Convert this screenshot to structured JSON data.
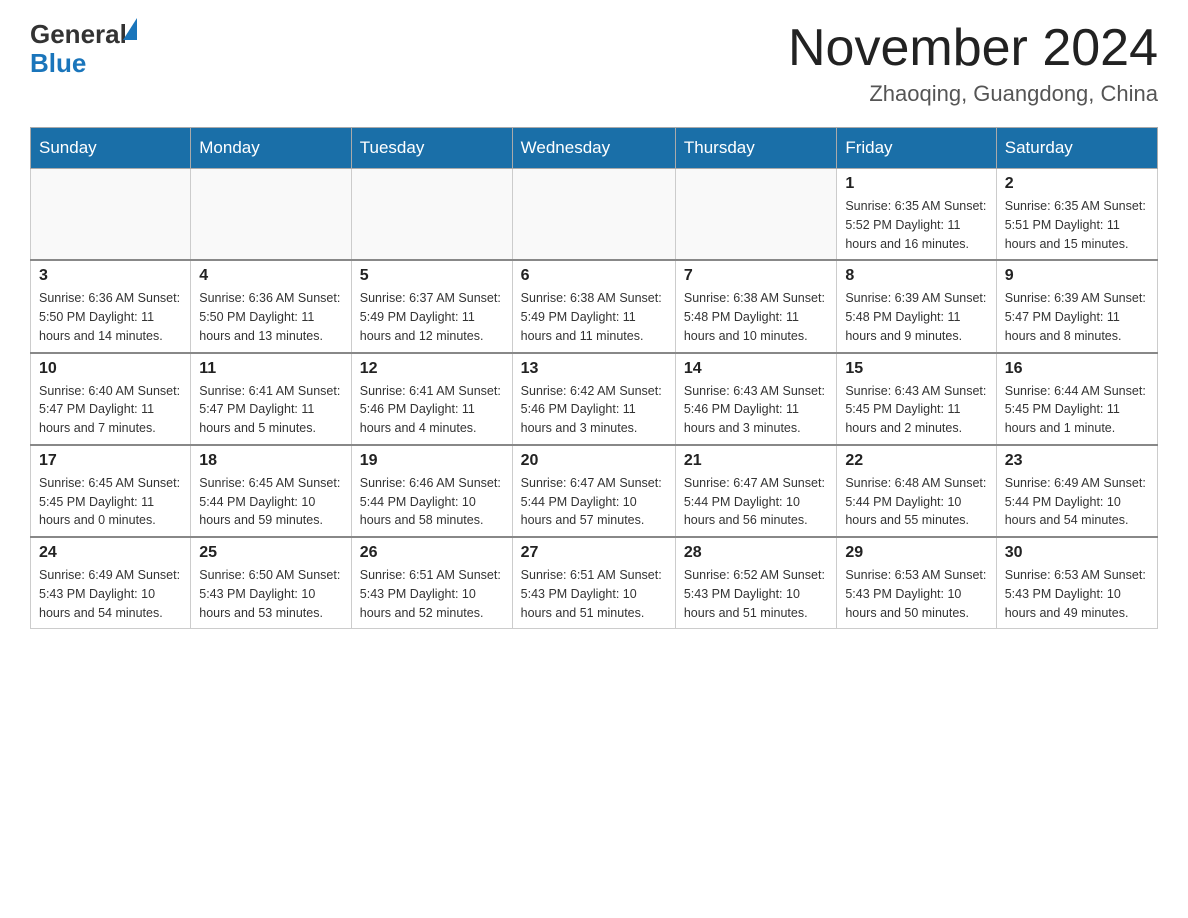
{
  "header": {
    "logo_general": "General",
    "logo_blue": "Blue",
    "title": "November 2024",
    "subtitle": "Zhaoqing, Guangdong, China"
  },
  "weekdays": [
    "Sunday",
    "Monday",
    "Tuesday",
    "Wednesday",
    "Thursday",
    "Friday",
    "Saturday"
  ],
  "weeks": [
    [
      {
        "day": "",
        "info": ""
      },
      {
        "day": "",
        "info": ""
      },
      {
        "day": "",
        "info": ""
      },
      {
        "day": "",
        "info": ""
      },
      {
        "day": "",
        "info": ""
      },
      {
        "day": "1",
        "info": "Sunrise: 6:35 AM\nSunset: 5:52 PM\nDaylight: 11 hours and 16 minutes."
      },
      {
        "day": "2",
        "info": "Sunrise: 6:35 AM\nSunset: 5:51 PM\nDaylight: 11 hours and 15 minutes."
      }
    ],
    [
      {
        "day": "3",
        "info": "Sunrise: 6:36 AM\nSunset: 5:50 PM\nDaylight: 11 hours and 14 minutes."
      },
      {
        "day": "4",
        "info": "Sunrise: 6:36 AM\nSunset: 5:50 PM\nDaylight: 11 hours and 13 minutes."
      },
      {
        "day": "5",
        "info": "Sunrise: 6:37 AM\nSunset: 5:49 PM\nDaylight: 11 hours and 12 minutes."
      },
      {
        "day": "6",
        "info": "Sunrise: 6:38 AM\nSunset: 5:49 PM\nDaylight: 11 hours and 11 minutes."
      },
      {
        "day": "7",
        "info": "Sunrise: 6:38 AM\nSunset: 5:48 PM\nDaylight: 11 hours and 10 minutes."
      },
      {
        "day": "8",
        "info": "Sunrise: 6:39 AM\nSunset: 5:48 PM\nDaylight: 11 hours and 9 minutes."
      },
      {
        "day": "9",
        "info": "Sunrise: 6:39 AM\nSunset: 5:47 PM\nDaylight: 11 hours and 8 minutes."
      }
    ],
    [
      {
        "day": "10",
        "info": "Sunrise: 6:40 AM\nSunset: 5:47 PM\nDaylight: 11 hours and 7 minutes."
      },
      {
        "day": "11",
        "info": "Sunrise: 6:41 AM\nSunset: 5:47 PM\nDaylight: 11 hours and 5 minutes."
      },
      {
        "day": "12",
        "info": "Sunrise: 6:41 AM\nSunset: 5:46 PM\nDaylight: 11 hours and 4 minutes."
      },
      {
        "day": "13",
        "info": "Sunrise: 6:42 AM\nSunset: 5:46 PM\nDaylight: 11 hours and 3 minutes."
      },
      {
        "day": "14",
        "info": "Sunrise: 6:43 AM\nSunset: 5:46 PM\nDaylight: 11 hours and 3 minutes."
      },
      {
        "day": "15",
        "info": "Sunrise: 6:43 AM\nSunset: 5:45 PM\nDaylight: 11 hours and 2 minutes."
      },
      {
        "day": "16",
        "info": "Sunrise: 6:44 AM\nSunset: 5:45 PM\nDaylight: 11 hours and 1 minute."
      }
    ],
    [
      {
        "day": "17",
        "info": "Sunrise: 6:45 AM\nSunset: 5:45 PM\nDaylight: 11 hours and 0 minutes."
      },
      {
        "day": "18",
        "info": "Sunrise: 6:45 AM\nSunset: 5:44 PM\nDaylight: 10 hours and 59 minutes."
      },
      {
        "day": "19",
        "info": "Sunrise: 6:46 AM\nSunset: 5:44 PM\nDaylight: 10 hours and 58 minutes."
      },
      {
        "day": "20",
        "info": "Sunrise: 6:47 AM\nSunset: 5:44 PM\nDaylight: 10 hours and 57 minutes."
      },
      {
        "day": "21",
        "info": "Sunrise: 6:47 AM\nSunset: 5:44 PM\nDaylight: 10 hours and 56 minutes."
      },
      {
        "day": "22",
        "info": "Sunrise: 6:48 AM\nSunset: 5:44 PM\nDaylight: 10 hours and 55 minutes."
      },
      {
        "day": "23",
        "info": "Sunrise: 6:49 AM\nSunset: 5:44 PM\nDaylight: 10 hours and 54 minutes."
      }
    ],
    [
      {
        "day": "24",
        "info": "Sunrise: 6:49 AM\nSunset: 5:43 PM\nDaylight: 10 hours and 54 minutes."
      },
      {
        "day": "25",
        "info": "Sunrise: 6:50 AM\nSunset: 5:43 PM\nDaylight: 10 hours and 53 minutes."
      },
      {
        "day": "26",
        "info": "Sunrise: 6:51 AM\nSunset: 5:43 PM\nDaylight: 10 hours and 52 minutes."
      },
      {
        "day": "27",
        "info": "Sunrise: 6:51 AM\nSunset: 5:43 PM\nDaylight: 10 hours and 51 minutes."
      },
      {
        "day": "28",
        "info": "Sunrise: 6:52 AM\nSunset: 5:43 PM\nDaylight: 10 hours and 51 minutes."
      },
      {
        "day": "29",
        "info": "Sunrise: 6:53 AM\nSunset: 5:43 PM\nDaylight: 10 hours and 50 minutes."
      },
      {
        "day": "30",
        "info": "Sunrise: 6:53 AM\nSunset: 5:43 PM\nDaylight: 10 hours and 49 minutes."
      }
    ]
  ]
}
